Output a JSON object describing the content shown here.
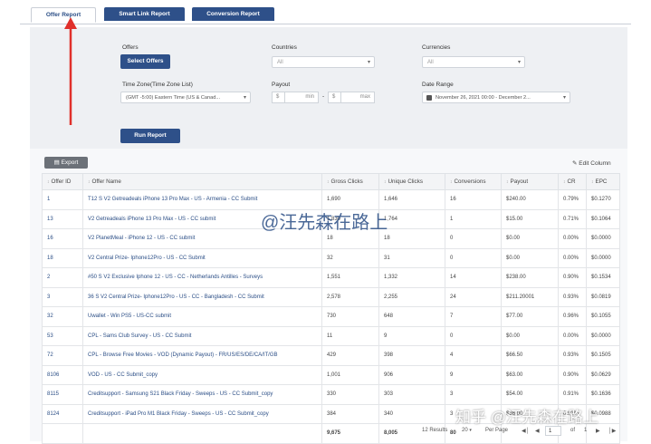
{
  "tabs": [
    {
      "label": "Offer Report",
      "active": true
    },
    {
      "label": "Smart Link Report",
      "active": false
    },
    {
      "label": "Conversion Report",
      "active": false
    }
  ],
  "filters": {
    "offers_label": "Offers",
    "select_offers_button": "Select Offers",
    "countries_label": "Countries",
    "countries_value": "All",
    "currencies_label": "Currencies",
    "currencies_value": "All",
    "timezone_label": "Time Zone(Time Zone List)",
    "timezone_value": "(GMT -5:00) Eastern Time (US & Canad...",
    "payout_label": "Payout",
    "payout_currency": "$",
    "payout_min": "min",
    "payout_sep": "-",
    "payout_currency2": "$",
    "payout_max": "max",
    "daterange_label": "Date Range",
    "daterange_value": "November 26, 2021 00:00 - December 2...",
    "run_report_button": "Run Report"
  },
  "toolbar": {
    "export_label": "Export",
    "edit_column_label": "Edit Column"
  },
  "table": {
    "columns": [
      "Offer ID",
      "Offer Name",
      "Gross Clicks",
      "Unique Clicks",
      "Conversions",
      "Payout",
      "CR",
      "EPC"
    ],
    "rows": [
      [
        "1",
        "T12 S V2 Getreadeals iPhone 13 Pro Max - US - Armenia - CC Submit",
        "1,690",
        "1,646",
        "16",
        "$240.00",
        "0.79%",
        "$0.1270"
      ],
      [
        "13",
        "V2 Getreadeals iPhone 13 Pro Max - US - CC submit",
        "1,830",
        "1,764",
        "1",
        "$15.00",
        "0.71%",
        "$0.1064"
      ],
      [
        "16",
        "V2 PlanetMeal - iPhone 12 - US - CC submit",
        "18",
        "18",
        "0",
        "$0.00",
        "0.00%",
        "$0.0000"
      ],
      [
        "18",
        "V2 Central Prize- Iphone12Pro - US - CC Submit",
        "32",
        "31",
        "0",
        "$0.00",
        "0.00%",
        "$0.0000"
      ],
      [
        "2",
        "#50 S V2 Exclusive Iphone 12 - US - CC - Netherlands Antilles - Surveys",
        "1,551",
        "1,332",
        "14",
        "$238.00",
        "0.90%",
        "$0.1534"
      ],
      [
        "3",
        "36 S V2 Central Prize- Iphone12Pro - US - CC - Bangladesh - CC Submit",
        "2,578",
        "2,255",
        "24",
        "$211.20001",
        "0.93%",
        "$0.0819"
      ],
      [
        "32",
        "Uwallet - Win PS5 - US-CC submit",
        "730",
        "648",
        "7",
        "$77.00",
        "0.96%",
        "$0.1055"
      ],
      [
        "53",
        "CPL - Sams Club Survey - US - CC Submit",
        "11",
        "9",
        "0",
        "$0.00",
        "0.00%",
        "$0.0000"
      ],
      [
        "72",
        "CPL - Browse Free Movies - VOD (Dynamic Payout) - FR/US/ES/DE/CA/IT/GB",
        "429",
        "398",
        "4",
        "$66.50",
        "0.93%",
        "$0.1505"
      ],
      [
        "8106",
        "VOD - US - CC Submit_copy",
        "1,001",
        "906",
        "9",
        "$63.00",
        "0.90%",
        "$0.0629"
      ],
      [
        "8115",
        "Creditsupport - Samsung S21 Black Friday - Sweeps - US - CC Submit_copy",
        "330",
        "303",
        "3",
        "$54.00",
        "0.91%",
        "$0.1636"
      ],
      [
        "8124",
        "Creditsupport - iPad Pro M1 Black Friday - Sweeps - US - CC Submit_copy",
        "384",
        "340",
        "3",
        "$36.00",
        "0.92%",
        "$0.0988"
      ]
    ],
    "totals": [
      "",
      "",
      "9,675",
      "8,005",
      "80",
      "",
      "",
      ""
    ]
  },
  "pager": {
    "results": "12 Results",
    "per_page_count": "20",
    "per_page_label": "Per Page",
    "page": "1",
    "of_label": "of",
    "total_pages": "1"
  },
  "watermark": {
    "main": "@汪先森在路上",
    "corner": "知乎 @汪先森在路上"
  },
  "colors": {
    "primary": "#2e5089",
    "link": "#2b4e86",
    "arrow": "#e0302b",
    "panel": "#eef0f3"
  }
}
